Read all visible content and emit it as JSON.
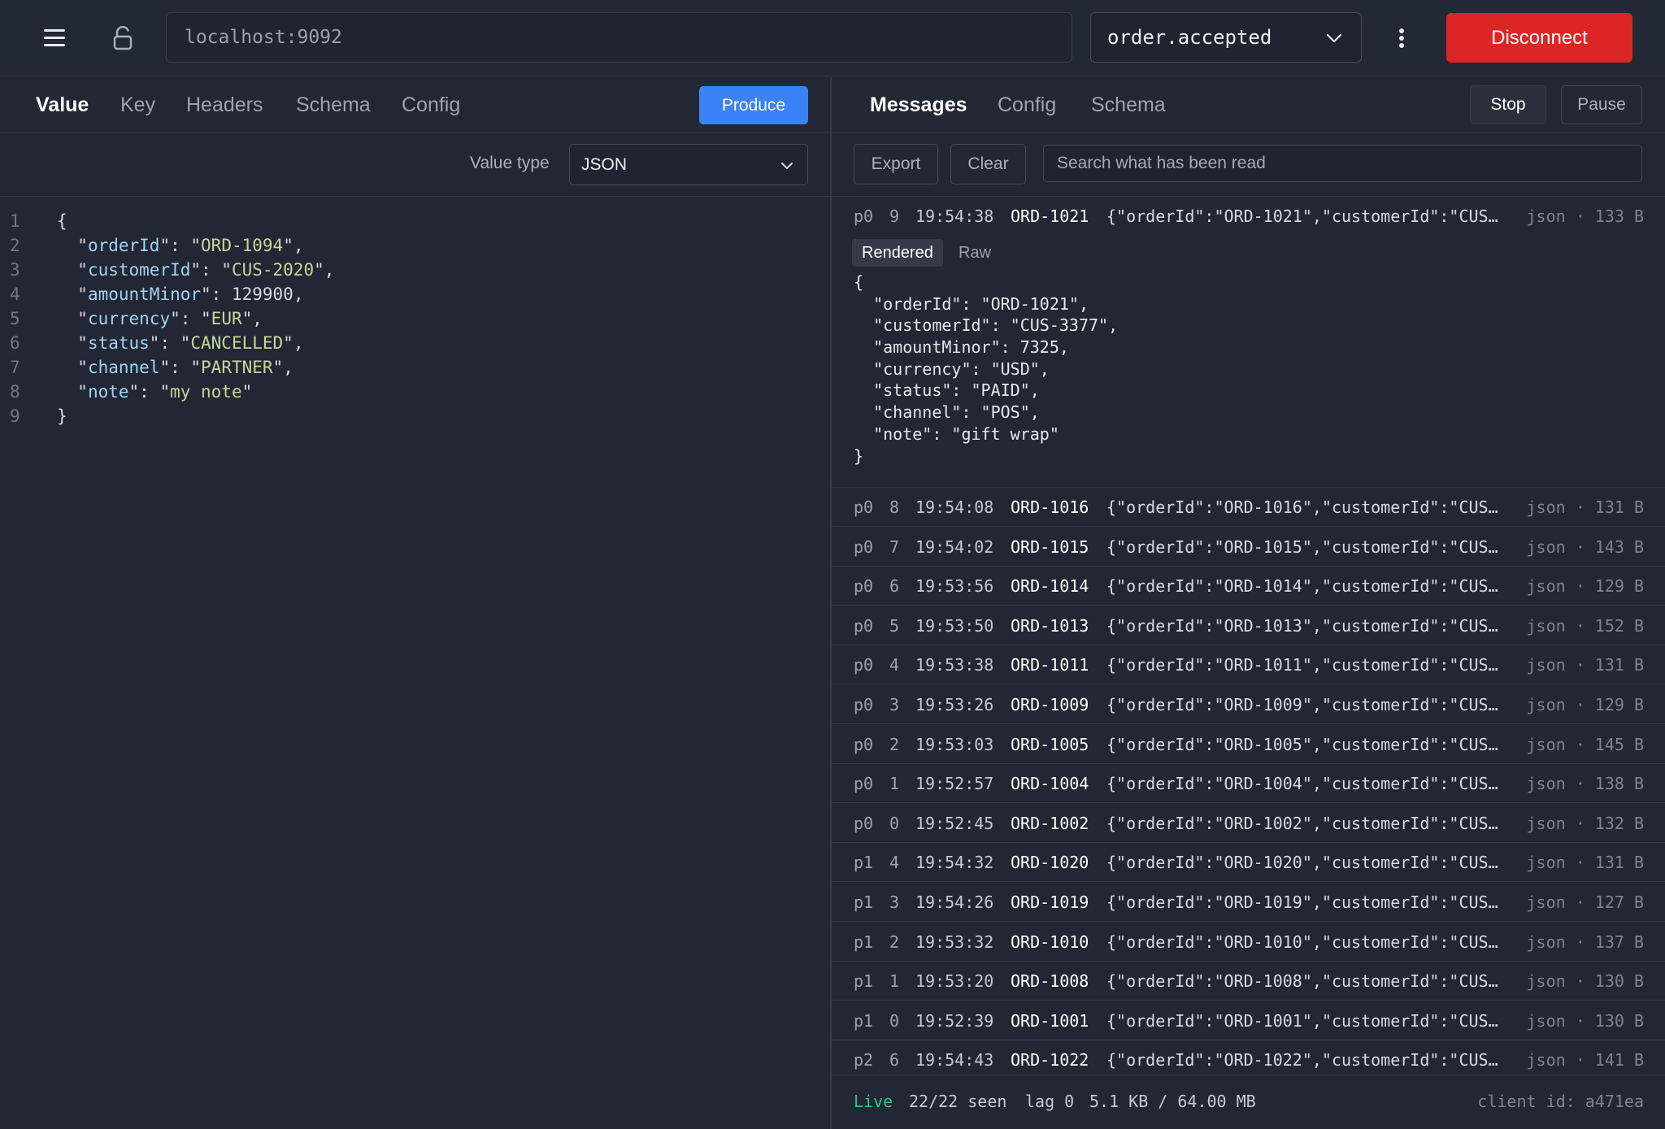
{
  "topbar": {
    "url": "localhost:9092",
    "topic": "order.accepted",
    "disconnect_label": "Disconnect"
  },
  "producer": {
    "tabs": [
      "Value",
      "Key",
      "Headers",
      "Schema",
      "Config"
    ],
    "active_tab": "Value",
    "produce_label": "Produce",
    "value_type_label": "Value type",
    "value_type": "JSON",
    "editor_line_numbers": [
      "1",
      "2",
      "3",
      "4",
      "5",
      "6",
      "7",
      "8",
      "9"
    ],
    "editor_json": [
      [
        "orderId",
        "ORD-1094"
      ],
      [
        "customerId",
        "CUS-2020"
      ],
      [
        "amountMinor",
        "129900"
      ],
      [
        "currency",
        "EUR"
      ],
      [
        "status",
        "CANCELLED"
      ],
      [
        "channel",
        "PARTNER"
      ],
      [
        "note",
        "my note"
      ]
    ]
  },
  "consumer": {
    "tabs": [
      "Messages",
      "Config",
      "Schema"
    ],
    "active_tab": "Messages",
    "stop_label": "Stop",
    "pause_label": "Pause",
    "export_label": "Export",
    "clear_label": "Clear",
    "search_placeholder": "Search what has been read",
    "expanded": {
      "partition": "p0",
      "offset": "9",
      "time": "19:54:38",
      "key": "ORD-1021",
      "preview": "{\"orderId\":\"ORD-1021\",\"customerId\":\"CUS…",
      "meta": "json · 133 B",
      "render_tabs": [
        "Rendered",
        "Raw"
      ],
      "json_lines": [
        "{",
        "  \"orderId\": \"ORD-1021\",",
        "  \"customerId\": \"CUS-3377\",",
        "  \"amountMinor\": 7325,",
        "  \"currency\": \"USD\",",
        "  \"status\": \"PAID\",",
        "  \"channel\": \"POS\",",
        "  \"note\": \"gift wrap\"",
        "}"
      ]
    },
    "messages": [
      {
        "partition": "p0",
        "offset": "8",
        "time": "19:54:08",
        "key": "ORD-1016",
        "preview": "{\"orderId\":\"ORD-1016\",\"customerId\":\"CUS…",
        "meta": "json · 131 B"
      },
      {
        "partition": "p0",
        "offset": "7",
        "time": "19:54:02",
        "key": "ORD-1015",
        "preview": "{\"orderId\":\"ORD-1015\",\"customerId\":\"CUS…",
        "meta": "json · 143 B"
      },
      {
        "partition": "p0",
        "offset": "6",
        "time": "19:53:56",
        "key": "ORD-1014",
        "preview": "{\"orderId\":\"ORD-1014\",\"customerId\":\"CUS…",
        "meta": "json · 129 B"
      },
      {
        "partition": "p0",
        "offset": "5",
        "time": "19:53:50",
        "key": "ORD-1013",
        "preview": "{\"orderId\":\"ORD-1013\",\"customerId\":\"CUS…",
        "meta": "json · 152 B"
      },
      {
        "partition": "p0",
        "offset": "4",
        "time": "19:53:38",
        "key": "ORD-1011",
        "preview": "{\"orderId\":\"ORD-1011\",\"customerId\":\"CUS…",
        "meta": "json · 131 B"
      },
      {
        "partition": "p0",
        "offset": "3",
        "time": "19:53:26",
        "key": "ORD-1009",
        "preview": "{\"orderId\":\"ORD-1009\",\"customerId\":\"CUS…",
        "meta": "json · 129 B"
      },
      {
        "partition": "p0",
        "offset": "2",
        "time": "19:53:03",
        "key": "ORD-1005",
        "preview": "{\"orderId\":\"ORD-1005\",\"customerId\":\"CUS…",
        "meta": "json · 145 B"
      },
      {
        "partition": "p0",
        "offset": "1",
        "time": "19:52:57",
        "key": "ORD-1004",
        "preview": "{\"orderId\":\"ORD-1004\",\"customerId\":\"CUS…",
        "meta": "json · 138 B"
      },
      {
        "partition": "p0",
        "offset": "0",
        "time": "19:52:45",
        "key": "ORD-1002",
        "preview": "{\"orderId\":\"ORD-1002\",\"customerId\":\"CUS…",
        "meta": "json · 132 B"
      },
      {
        "partition": "p1",
        "offset": "4",
        "time": "19:54:32",
        "key": "ORD-1020",
        "preview": "{\"orderId\":\"ORD-1020\",\"customerId\":\"CUS…",
        "meta": "json · 131 B"
      },
      {
        "partition": "p1",
        "offset": "3",
        "time": "19:54:26",
        "key": "ORD-1019",
        "preview": "{\"orderId\":\"ORD-1019\",\"customerId\":\"CUS…",
        "meta": "json · 127 B"
      },
      {
        "partition": "p1",
        "offset": "2",
        "time": "19:53:32",
        "key": "ORD-1010",
        "preview": "{\"orderId\":\"ORD-1010\",\"customerId\":\"CUS…",
        "meta": "json · 137 B"
      },
      {
        "partition": "p1",
        "offset": "1",
        "time": "19:53:20",
        "key": "ORD-1008",
        "preview": "{\"orderId\":\"ORD-1008\",\"customerId\":\"CUS…",
        "meta": "json · 130 B"
      },
      {
        "partition": "p1",
        "offset": "0",
        "time": "19:52:39",
        "key": "ORD-1001",
        "preview": "{\"orderId\":\"ORD-1001\",\"customerId\":\"CUS…",
        "meta": "json · 130 B"
      },
      {
        "partition": "p2",
        "offset": "6",
        "time": "19:54:43",
        "key": "ORD-1022",
        "preview": "{\"orderId\":\"ORD-1022\",\"customerId\":\"CUS…",
        "meta": "json · 141 B"
      }
    ],
    "status": {
      "live": "Live",
      "seen": "22/22 seen",
      "lag": "lag 0",
      "size": "5.1 KB / 64.00 MB",
      "client_id": "client id: a471ea"
    }
  },
  "colors": {
    "background": "#222733",
    "accent_blue": "#3b82f6",
    "danger_red": "#dc2626",
    "live_green": "#34c08a",
    "json_key": "#9fd3f4",
    "json_string": "#c3d89a"
  },
  "icons": [
    "menu-icon",
    "unlock-icon",
    "chevron-down-icon",
    "more-vertical-icon"
  ]
}
